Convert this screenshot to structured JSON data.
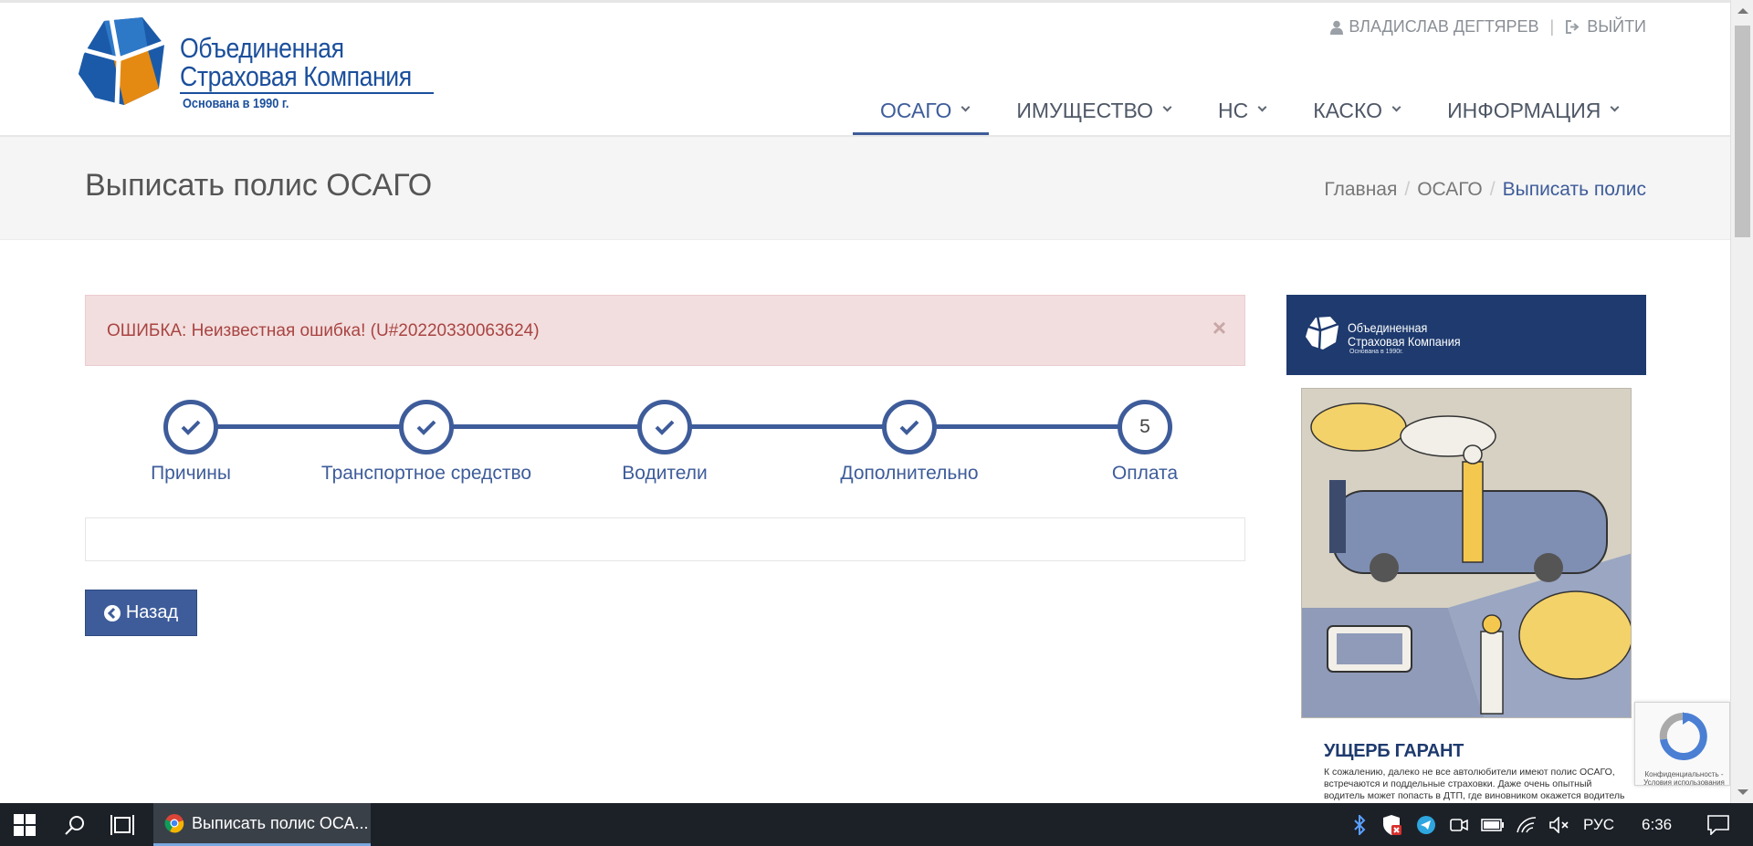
{
  "header": {
    "logo": {
      "line1": "Объединенная",
      "line2": "Страховая Компания",
      "sub": "Основана в 1990 г."
    },
    "user": {
      "name": "ВЛАДИСЛАВ ДЕГТЯРЕВ",
      "logout": "ВЫЙТИ"
    },
    "nav": [
      "ОСАГО",
      "ИМУЩЕСТВО",
      "НС",
      "КАСКО",
      "ИНФОРМАЦИЯ"
    ]
  },
  "page": {
    "title": "Выписать полис ОСАГО",
    "breadcrumb": [
      "Главная",
      "ОСАГО",
      "Выписать полис"
    ]
  },
  "alert": {
    "text": "ОШИБКА: Неизвестная ошибка! (U#20220330063624)",
    "close": "×"
  },
  "steps": [
    {
      "label": "Причины",
      "done": true
    },
    {
      "label": "Транспортное средство",
      "done": true
    },
    {
      "label": "Водители",
      "done": true
    },
    {
      "label": "Дополнительно",
      "done": true
    },
    {
      "label": "Оплата",
      "number": "5",
      "done": false
    }
  ],
  "back_button": "Назад",
  "sidebar": {
    "banner": {
      "line1": "Объединенная",
      "line2": "Страховая Компания",
      "sub": "Основана в 1990г."
    },
    "ad_title": "УЩЕРБ ГАРАНТ",
    "ad_text": "К сожалению, далеко не все автолюбители имеют полис ОСАГО, встречаются и поддельные страховки. Даже очень опытный водитель может попасть в ДТП, где виновником окажется водитель",
    "recaptcha_text": "Конфиденциальность - Условия использования"
  },
  "taskbar": {
    "app_label": "Выписать полис ОСА...",
    "lang": "РУС",
    "time": "6:36"
  },
  "colors": {
    "brand": "#3e5c9a",
    "alert_bg": "#f2dede",
    "alert_text": "#a94442",
    "taskbar": "#1c2128"
  }
}
